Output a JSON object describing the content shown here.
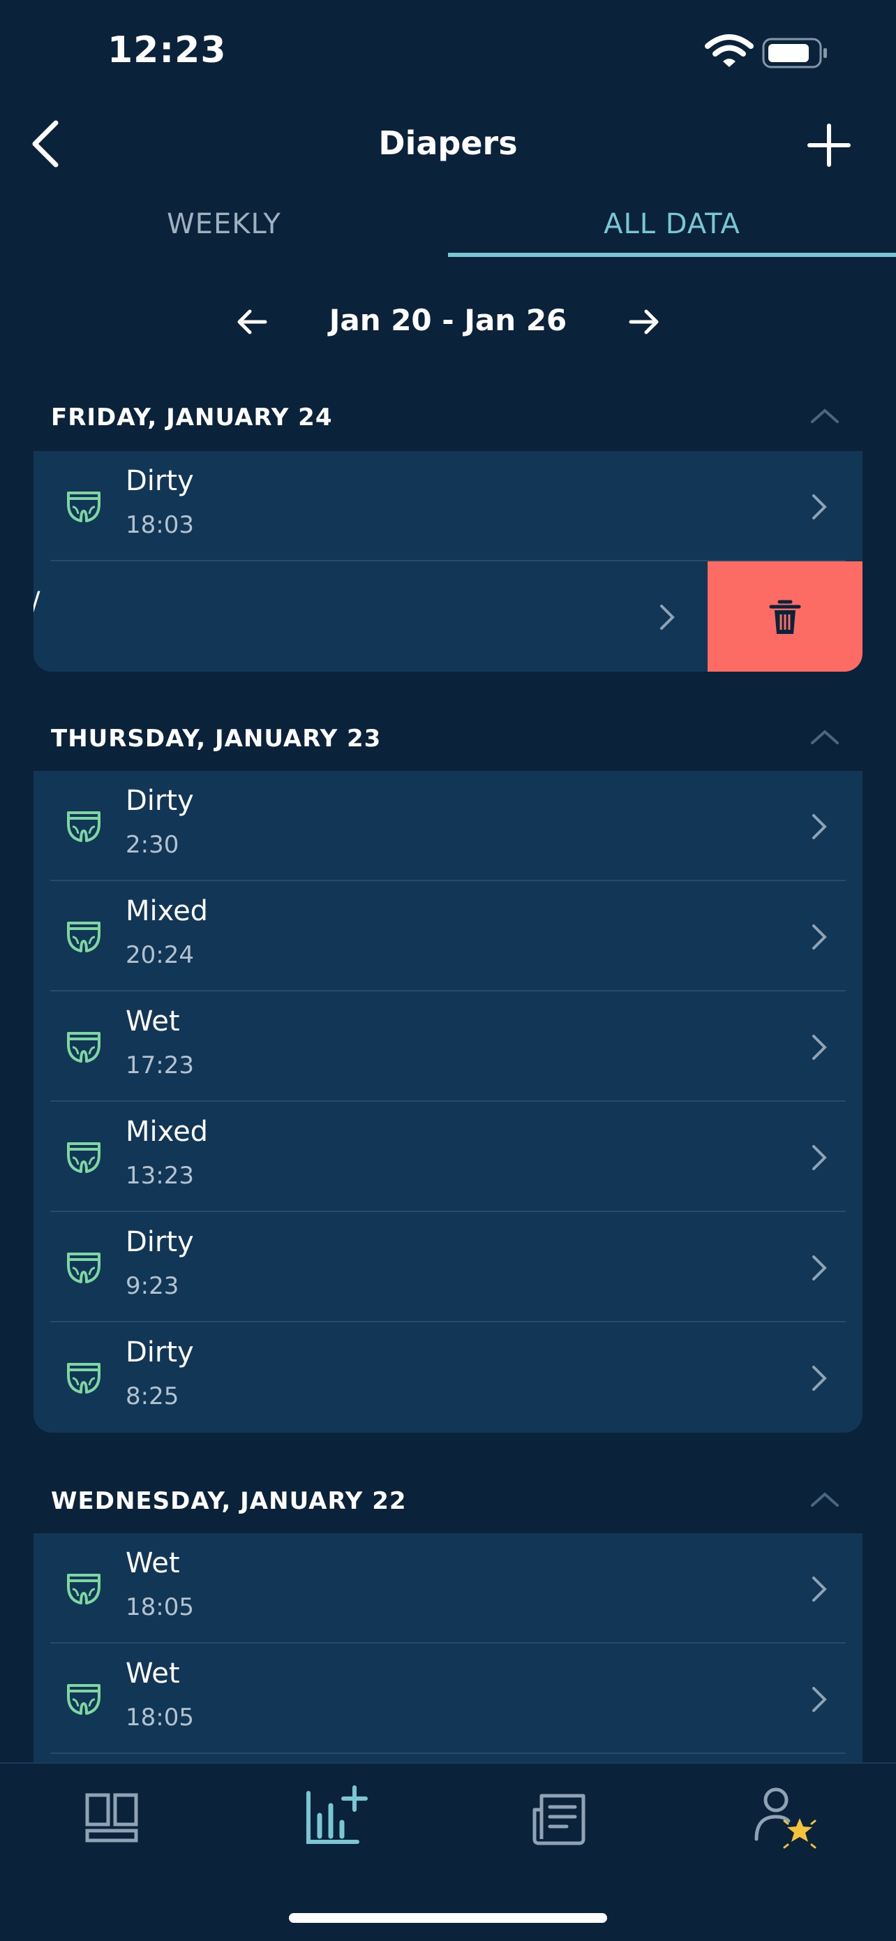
{
  "status_bar": {
    "time": "12:23"
  },
  "header": {
    "title": "Diapers"
  },
  "tabs": [
    {
      "label": "WEEKLY"
    },
    {
      "label": "ALL DATA"
    }
  ],
  "date_range": {
    "label": "Jan 20 - Jan 26"
  },
  "sections": [
    {
      "title": "FRIDAY, JANUARY 24",
      "rows": [
        {
          "label": "Dirty",
          "time": "18:03"
        }
      ]
    },
    {
      "title": "THURSDAY, JANUARY 23",
      "rows": [
        {
          "label": "Dirty",
          "time": "2:30"
        },
        {
          "label": "Mixed",
          "time": "20:24"
        },
        {
          "label": "Wet",
          "time": "17:23"
        },
        {
          "label": "Mixed",
          "time": "13:23"
        },
        {
          "label": "Dirty",
          "time": "9:23"
        },
        {
          "label": "Dirty",
          "time": "8:25"
        }
      ]
    },
    {
      "title": "WEDNESDAY, JANUARY 22",
      "rows": [
        {
          "label": "Wet",
          "time": "18:05"
        },
        {
          "label": "Wet",
          "time": "18:05"
        }
      ]
    }
  ],
  "bottom_nav": [
    {
      "icon": "dashboard-icon"
    },
    {
      "icon": "add-chart-icon",
      "active": true
    },
    {
      "icon": "articles-icon"
    },
    {
      "icon": "profile-star-icon"
    }
  ],
  "colors": {
    "background": "#0a223a",
    "card": "#123656",
    "accent": "#79c7d3",
    "diaper_icon": "#7fd6a0",
    "delete": "#fd6b65"
  }
}
